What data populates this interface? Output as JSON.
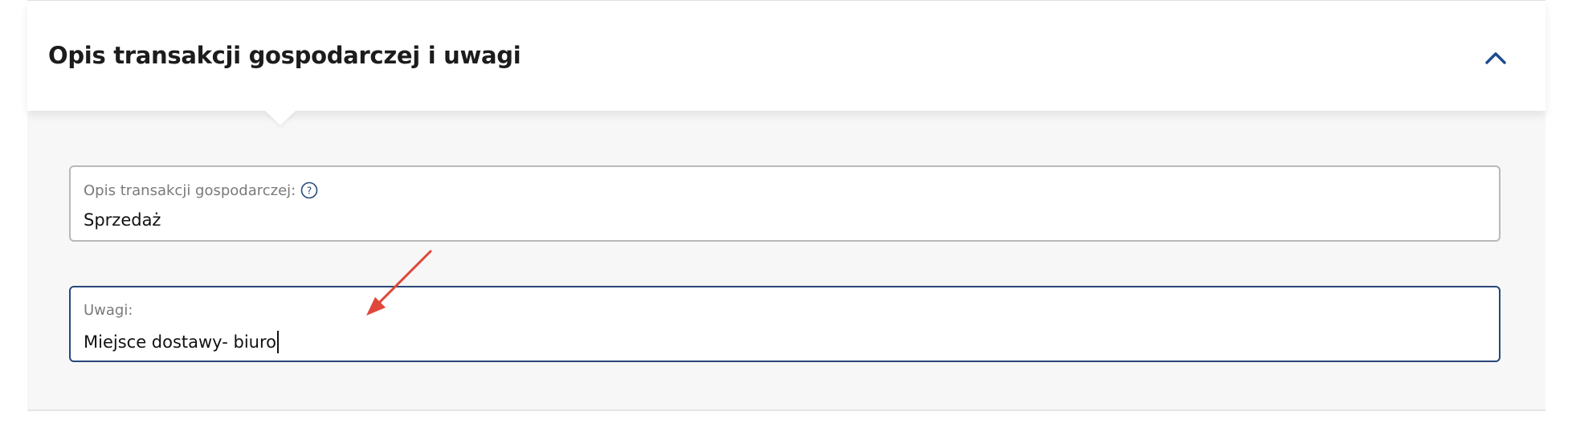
{
  "section": {
    "title": "Opis transakcji gospodarczej i uwagi",
    "collapse_icon": "chevron-up-icon"
  },
  "fields": {
    "description": {
      "label": "Opis transakcji gospodarczej:",
      "help_icon": "question-circle-icon",
      "value": "Sprzedaż"
    },
    "notes": {
      "label": "Uwagi:",
      "value": "Miejsce dostawy- biuro",
      "focused": true
    }
  },
  "colors": {
    "accent_border": "#27487a",
    "chevron": "#1f4b8f",
    "annotation_arrow": "#e0473a"
  }
}
